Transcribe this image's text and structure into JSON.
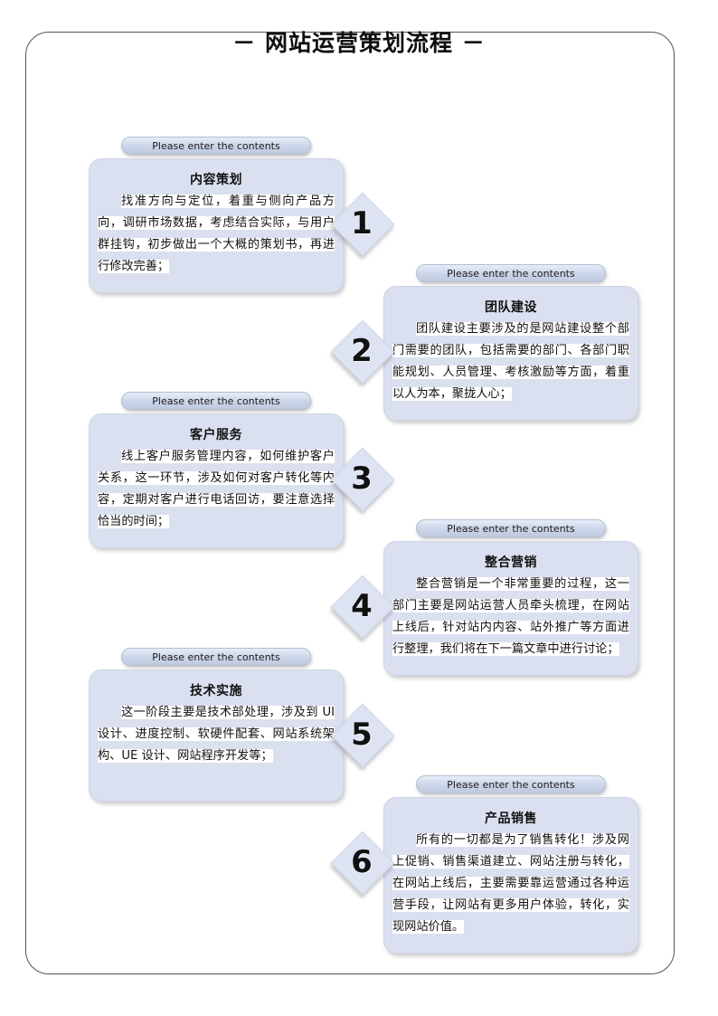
{
  "document": {
    "title": "－ 网站运营策划流程 －",
    "pill_label": "Please enter the contents",
    "frame_color": "#545454",
    "box_fill": "#dbe0f0",
    "pill_fill": "#ccd5e9",
    "text_color": "#111111"
  },
  "steps": [
    {
      "number": "1",
      "side": "left",
      "arrow_direction": "right",
      "pill": "Please enter the contents",
      "title": "内容策划",
      "body": "找准方向与定位，着重与侧向产品方向，调研市场数据，考虑结合实际，与用户群挂钩，初步做出一个大概的策划书，再进行修改完善；"
    },
    {
      "number": "2",
      "side": "right",
      "arrow_direction": "left",
      "pill": "Please enter the contents",
      "title": "团队建设",
      "body": "团队建设主要涉及的是网站建设整个部门需要的团队，包括需要的部门、各部门职能规划、人员管理、考核激励等方面，着重以人为本，聚拢人心；"
    },
    {
      "number": "3",
      "side": "left",
      "arrow_direction": "right",
      "pill": "Please enter the contents",
      "title": "客户服务",
      "body": "线上客户服务管理内容，如何维护客户关系，这一环节，涉及如何对客户转化等内容，定期对客户进行电话回访，要注意选择恰当的时间；"
    },
    {
      "number": "4",
      "side": "right",
      "arrow_direction": "left",
      "pill": "Please enter the contents",
      "title": "整合营销",
      "body": "整合营销是一个非常重要的过程，这一部门主要是网站运营人员牵头梳理，在网站上线后，针对站内内容、站外推广等方面进行整理，我们将在下一篇文章中进行讨论；"
    },
    {
      "number": "5",
      "side": "left",
      "arrow_direction": "right",
      "pill": "Please enter the contents",
      "title": "技术实施",
      "body": "这一阶段主要是技术部处理，涉及到 UI 设计、进度控制、软硬件配套、网站系统架构、UE 设计、网站程序开发等；"
    },
    {
      "number": "6",
      "side": "right",
      "arrow_direction": "left",
      "pill": "Please enter the contents",
      "title": "产品销售",
      "body": "所有的一切都是为了销售转化！涉及网上促销、销售渠道建立、网站注册与转化，在网站上线后，主要需要靠运营通过各种运营手段，让网站有更多用户体验，转化，实现网站价值。"
    }
  ]
}
